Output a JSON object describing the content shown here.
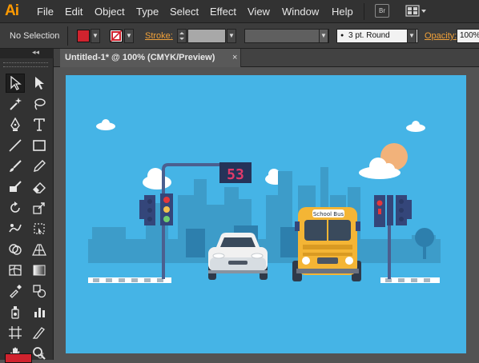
{
  "app": {
    "logo": "Ai"
  },
  "menu": [
    "File",
    "Edit",
    "Object",
    "Type",
    "Select",
    "Effect",
    "View",
    "Window",
    "Help"
  ],
  "bridge_button": "Br",
  "control_bar": {
    "selection_status": "No Selection",
    "fill_color": "#d0232e",
    "stroke_label": "Stroke:",
    "brush": "3 pt. Round",
    "opacity_label": "Opacity:",
    "opacity_value": "100%"
  },
  "document_tab": {
    "title": "Untitled-1* @ 100% (CMYK/Preview)",
    "close": "×"
  },
  "toolbar": {
    "collapse": "◂◂",
    "tools": [
      "selection-tool",
      "direct-selection-tool",
      "magic-wand-tool",
      "lasso-tool",
      "pen-tool",
      "type-tool",
      "line-tool",
      "rectangle-tool",
      "paintbrush-tool",
      "pencil-tool",
      "blob-brush-tool",
      "eraser-tool",
      "rotate-tool",
      "scale-tool",
      "warp-tool",
      "free-transform-tool",
      "shape-builder-tool",
      "perspective-grid-tool",
      "mesh-tool",
      "gradient-tool",
      "eyedropper-tool",
      "blend-tool",
      "symbol-sprayer-tool",
      "column-graph-tool",
      "artboard-tool",
      "slice-tool",
      "hand-tool",
      "zoom-tool"
    ]
  },
  "artwork": {
    "traffic_counter": "53",
    "bus_sign": "School Bus",
    "sky_color": "#45b4e6",
    "sun_color": "#f2b27a",
    "bus_color": "#f4b535",
    "car_color": "#f1f1f1"
  }
}
